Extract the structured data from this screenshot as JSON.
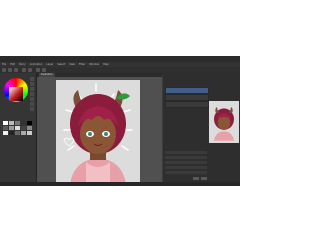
{
  "menu": [
    "File",
    "Edit",
    "Story",
    "Animation",
    "Layer",
    "Select",
    "View",
    "Filter",
    "Window",
    "Help"
  ],
  "canvas": {
    "tab_label": "Illustration"
  },
  "status": {
    "zoom": ""
  },
  "colors": {
    "panel": "#3c3c3c",
    "canvas": "#505050",
    "accent": "#3f5f8a"
  }
}
